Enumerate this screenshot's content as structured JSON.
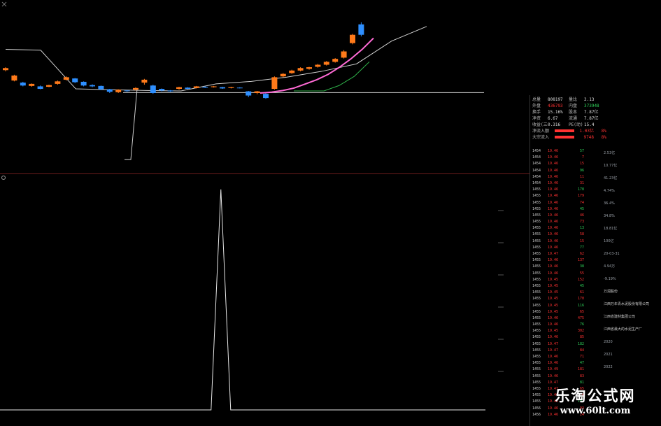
{
  "colors": {
    "background": "#000000",
    "rise": "#ff3232",
    "fall": "#2e8fff",
    "candle_up": "#ff7a1a",
    "ma_pink": "#ff6ad5",
    "indicator_line": "#e8e8e8",
    "envelope_line": "#cfcfcf",
    "green_line": "#2fb34a",
    "divider": "#6b1d1d"
  },
  "icons": {
    "toolbar_close": "close-icon",
    "indicator_settings": "gear-icon"
  },
  "top_chart": {
    "type": "candlestick",
    "candles": [
      {
        "o": 0.85,
        "c": 0.9,
        "h": 0.92,
        "l": 0.82
      },
      {
        "o": 0.6,
        "c": 0.72,
        "h": 0.74,
        "l": 0.58
      },
      {
        "o": 0.55,
        "c": 0.48,
        "h": 0.57,
        "l": 0.46
      },
      {
        "o": 0.47,
        "c": 0.52,
        "h": 0.53,
        "l": 0.45
      },
      {
        "o": 0.46,
        "c": 0.4,
        "h": 0.48,
        "l": 0.39
      },
      {
        "o": 0.45,
        "c": 0.49,
        "h": 0.5,
        "l": 0.44
      },
      {
        "o": 0.52,
        "c": 0.58,
        "h": 0.6,
        "l": 0.5
      },
      {
        "o": 0.62,
        "c": 0.68,
        "h": 0.7,
        "l": 0.6
      },
      {
        "o": 0.65,
        "c": 0.56,
        "h": 0.66,
        "l": 0.54
      },
      {
        "o": 0.57,
        "c": 0.48,
        "h": 0.58,
        "l": 0.46
      },
      {
        "o": 0.49,
        "c": 0.46,
        "h": 0.51,
        "l": 0.44
      },
      {
        "o": 0.47,
        "c": 0.39,
        "h": 0.48,
        "l": 0.37
      },
      {
        "o": 0.39,
        "c": 0.33,
        "h": 0.4,
        "l": 0.3
      },
      {
        "o": 0.32,
        "c": 0.38,
        "h": 0.39,
        "l": 0.3
      },
      {
        "o": 0.36,
        "c": 0.35,
        "h": 0.37,
        "l": 0.33
      },
      {
        "o": 0.38,
        "c": 0.42,
        "h": 0.44,
        "l": 0.36
      },
      {
        "o": 0.55,
        "c": 0.62,
        "h": 0.64,
        "l": 0.5
      },
      {
        "o": 0.48,
        "c": 0.3,
        "h": 0.5,
        "l": 0.28
      },
      {
        "o": 0.4,
        "c": 0.36,
        "h": 0.41,
        "l": 0.34
      },
      {
        "o": 0.36,
        "c": 0.34,
        "h": 0.37,
        "l": 0.33
      },
      {
        "o": 0.4,
        "c": 0.44,
        "h": 0.45,
        "l": 0.38
      },
      {
        "o": 0.43,
        "c": 0.4,
        "h": 0.44,
        "l": 0.39
      },
      {
        "o": 0.42,
        "c": 0.46,
        "h": 0.47,
        "l": 0.41
      },
      {
        "o": 0.45,
        "c": 0.43,
        "h": 0.46,
        "l": 0.42
      },
      {
        "o": 0.44,
        "c": 0.46,
        "h": 0.47,
        "l": 0.43
      },
      {
        "o": 0.44,
        "c": 0.41,
        "h": 0.45,
        "l": 0.4
      },
      {
        "o": 0.42,
        "c": 0.44,
        "h": 0.45,
        "l": 0.41
      },
      {
        "o": 0.43,
        "c": 0.42,
        "h": 0.44,
        "l": 0.41
      },
      {
        "o": 0.34,
        "c": 0.24,
        "h": 0.35,
        "l": 0.2
      },
      {
        "o": 0.3,
        "c": 0.34,
        "h": 0.35,
        "l": 0.27
      },
      {
        "o": 0.28,
        "c": 0.18,
        "h": 0.3,
        "l": 0.16
      },
      {
        "o": 0.4,
        "c": 0.68,
        "h": 0.7,
        "l": 0.38
      },
      {
        "o": 0.7,
        "c": 0.76,
        "h": 0.78,
        "l": 0.68
      },
      {
        "o": 0.78,
        "c": 0.84,
        "h": 0.86,
        "l": 0.76
      },
      {
        "o": 0.84,
        "c": 0.9,
        "h": 0.92,
        "l": 0.82
      },
      {
        "o": 0.88,
        "c": 0.92,
        "h": 0.93,
        "l": 0.86
      },
      {
        "o": 0.93,
        "c": 0.98,
        "h": 1.0,
        "l": 0.91
      },
      {
        "o": 0.98,
        "c": 1.05,
        "h": 1.07,
        "l": 0.96
      },
      {
        "o": 1.05,
        "c": 1.12,
        "h": 1.14,
        "l": 1.03
      },
      {
        "o": 1.15,
        "c": 1.3,
        "h": 1.33,
        "l": 1.13
      },
      {
        "o": 1.5,
        "c": 1.7,
        "h": 1.72,
        "l": 1.47
      },
      {
        "o": 1.95,
        "c": 1.7,
        "h": 2.0,
        "l": 1.66
      }
    ],
    "ma_pink": [
      0.3,
      0.32,
      0.36,
      0.42,
      0.52,
      0.62,
      0.75,
      0.92,
      1.12,
      1.35,
      1.62
    ],
    "envelope_upper": [
      1.35,
      1.33,
      0.4,
      0.38,
      0.36,
      0.35,
      0.52,
      0.58,
      0.68,
      0.82,
      1.0,
      1.55,
      1.9
    ],
    "envelope_lower": [
      -1.3,
      -1.3,
      0.4
    ],
    "green_line": [
      0.35,
      0.35,
      0.35,
      0.48,
      0.7,
      1.05
    ],
    "flat_line": 0.31
  },
  "indicator_chart": {
    "type": "line",
    "baseline": 0,
    "spike": {
      "position": 0.455,
      "value": 1.0
    },
    "ylim": [
      0,
      1.05
    ]
  },
  "trade_list": {
    "rows": [
      {
        "time": "1454",
        "price": "19.46",
        "vol": "57"
      },
      {
        "time": "1454",
        "price": "19.46",
        "vol": "7"
      },
      {
        "time": "1454",
        "price": "19.46",
        "vol": "15"
      },
      {
        "time": "1454",
        "price": "19.46",
        "vol": "96"
      },
      {
        "time": "1454",
        "price": "19.46",
        "vol": "11"
      },
      {
        "time": "1454",
        "price": "19.46",
        "vol": "31"
      },
      {
        "time": "1455",
        "price": "19.46",
        "vol": "178"
      },
      {
        "time": "1455",
        "price": "19.46",
        "vol": "179"
      },
      {
        "time": "1455",
        "price": "19.46",
        "vol": "74"
      },
      {
        "time": "1455",
        "price": "19.46",
        "vol": "45"
      },
      {
        "time": "1455",
        "price": "19.46",
        "vol": "46"
      },
      {
        "time": "1455",
        "price": "19.46",
        "vol": "73"
      },
      {
        "time": "1455",
        "price": "19.46",
        "vol": "13"
      },
      {
        "time": "1455",
        "price": "19.46",
        "vol": "58"
      },
      {
        "time": "1455",
        "price": "19.46",
        "vol": "15"
      },
      {
        "time": "1455",
        "price": "19.46",
        "vol": "77"
      },
      {
        "time": "1455",
        "price": "19.47",
        "vol": "62"
      },
      {
        "time": "1455",
        "price": "19.46",
        "vol": "137"
      },
      {
        "time": "1455",
        "price": "19.46",
        "vol": "38"
      },
      {
        "time": "1455",
        "price": "19.46",
        "vol": "55"
      },
      {
        "time": "1455",
        "price": "19.45",
        "vol": "152"
      },
      {
        "time": "1455",
        "price": "19.45",
        "vol": "45"
      },
      {
        "time": "1455",
        "price": "19.45",
        "vol": "61"
      },
      {
        "time": "1455",
        "price": "19.45",
        "vol": "170"
      },
      {
        "time": "1455",
        "price": "19.45",
        "vol": "116"
      },
      {
        "time": "1455",
        "price": "19.45",
        "vol": "65"
      },
      {
        "time": "1455",
        "price": "19.46",
        "vol": "475"
      },
      {
        "time": "1455",
        "price": "19.46",
        "vol": "76"
      },
      {
        "time": "1455",
        "price": "19.45",
        "vol": "302"
      },
      {
        "time": "1455",
        "price": "19.46",
        "vol": "85"
      },
      {
        "time": "1455",
        "price": "19.47",
        "vol": "182"
      },
      {
        "time": "1455",
        "price": "19.47",
        "vol": "84"
      },
      {
        "time": "1455",
        "price": "19.46",
        "vol": "71"
      },
      {
        "time": "1455",
        "price": "19.46",
        "vol": "47"
      },
      {
        "time": "1455",
        "price": "19.49",
        "vol": "181"
      },
      {
        "time": "1455",
        "price": "19.46",
        "vol": "83"
      },
      {
        "time": "1455",
        "price": "19.47",
        "vol": "81"
      },
      {
        "time": "1455",
        "price": "19.47",
        "vol": "65"
      },
      {
        "time": "1455",
        "price": "19.46",
        "vol": "74"
      },
      {
        "time": "1455",
        "price": "19.46",
        "vol": "192"
      },
      {
        "time": "1456",
        "price": "19.46",
        "vol": "93"
      },
      {
        "time": "1456",
        "price": "19.46",
        "vol": "24"
      }
    ]
  },
  "quote_panel": {
    "rows": [
      {
        "label": "总量",
        "value": "808197",
        "label2": "量比",
        "value2": "2.13"
      },
      {
        "label": "外盘",
        "value": "436793",
        "label2": "内盘",
        "value2": "373948"
      },
      {
        "label": "换手",
        "value": "15.16%",
        "label2": "股本",
        "value2": "7.87亿"
      },
      {
        "label": "净资",
        "value": "6.67",
        "label2": "流通",
        "value2": "7.87亿"
      },
      {
        "label": "收益(三)",
        "value": "0.316",
        "label2": "PE(动)",
        "value2": "15.4"
      }
    ],
    "flow_in_label": "净流入额",
    "flow_in_value": "1.03亿",
    "flow_in_pct": "8%",
    "big_order_label": "大宗流入",
    "big_order_value": "9748",
    "big_order_pct": "8%"
  },
  "info_panel": {
    "lines": [
      "2.53亿",
      "10.77亿",
      "41.23亿",
      "4.74%",
      "36.4%",
      "34.8%",
      "18.81亿",
      "100亿",
      "20-03-31",
      "4.94万",
      "-9.19%",
      "万润股份",
      "江西万年青水泥股份有限公司",
      "江西省建材集团公司",
      "江西省最大的水泥生产厂",
      "2020",
      "2021",
      "2022"
    ]
  },
  "brand": {
    "title": "乐淘公式网",
    "url": "www.60lt.com"
  }
}
